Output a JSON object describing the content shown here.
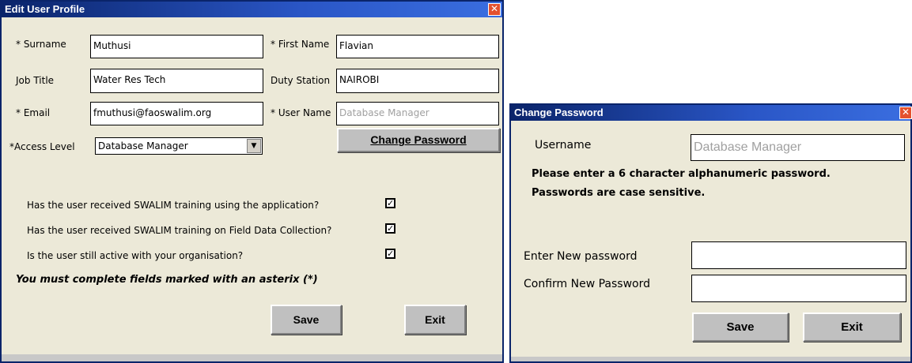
{
  "edit_profile": {
    "title": "Edit User Profile",
    "surname_label": "* Surname",
    "surname_value": "Muthusi",
    "first_name_label": "* First Name",
    "first_name_value": "Flavian",
    "job_title_label": "Job Title",
    "job_title_value": "Water Res Tech",
    "duty_station_label": "Duty Station",
    "duty_station_value": "NAIROBI",
    "email_label": "* Email",
    "email_value": "fmuthusi@faoswalim.org",
    "user_name_label": "* User Name",
    "user_name_value": "Database Manager",
    "access_level_label": "*Access Level",
    "access_level_value": "Database Manager",
    "change_password_label": "Change Password",
    "questions": [
      {
        "text": "Has the user received SWALIM training using the application?",
        "checked": true
      },
      {
        "text": "Has the user received SWALIM training on Field Data Collection?",
        "checked": true
      },
      {
        "text": "Is the user still active with your organisation?",
        "checked": true
      }
    ],
    "required_note": "You must complete fields marked with an asterix (*)",
    "save_label": "Save",
    "exit_label": "Exit"
  },
  "change_password": {
    "title": "Change Password",
    "username_label": "Username",
    "username_value": "Database Manager",
    "instruction_line1": "Please enter a 6 character alphanumeric password.",
    "instruction_line2": "Passwords are case sensitive.",
    "new_password_label": "Enter New password",
    "new_password_value": "",
    "confirm_password_label": "Confirm New Password",
    "confirm_password_value": "",
    "save_label": "Save",
    "exit_label": "Exit"
  },
  "icons": {
    "close": "close-icon",
    "dropdown": "chevron-down-icon",
    "check": "checkmark-icon"
  },
  "colors": {
    "titlebar": "#0a246a",
    "window_bg": "#ece9d8",
    "button_bg": "#c0c0c0",
    "close_button": "#e4512e"
  }
}
